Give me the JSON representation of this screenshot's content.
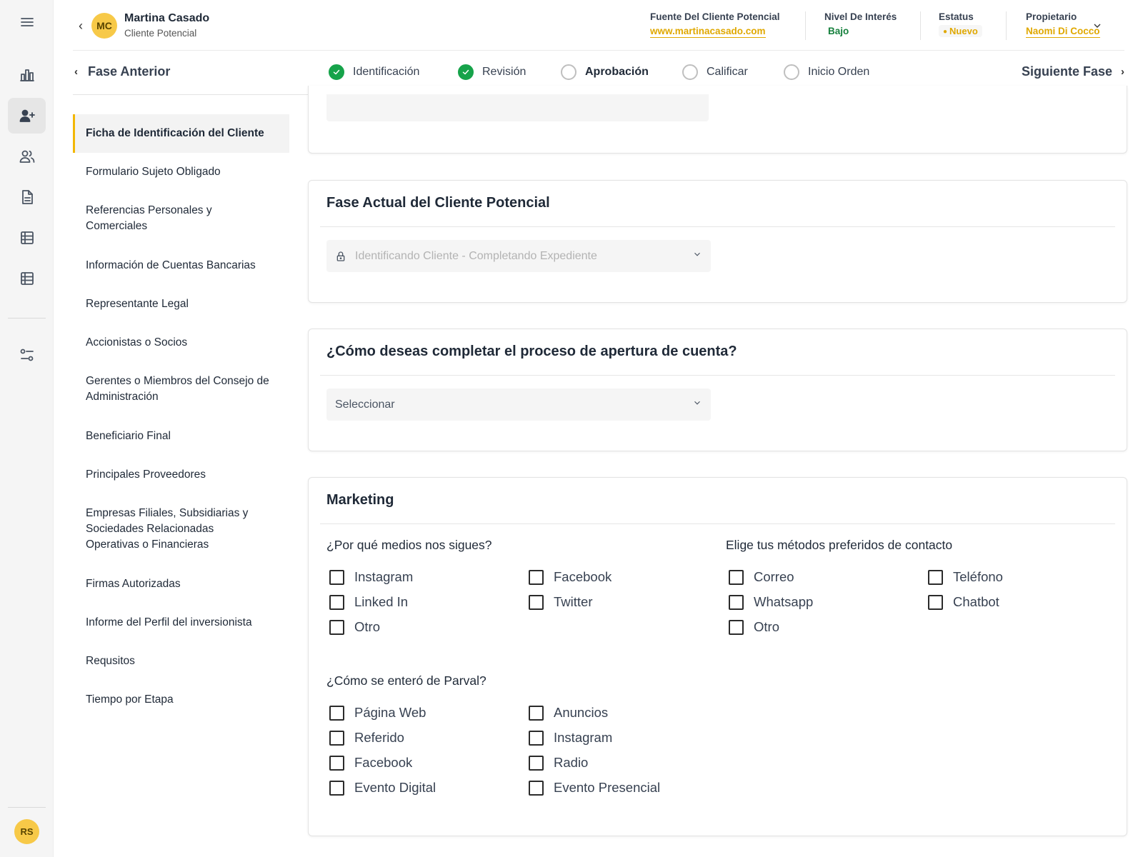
{
  "user": {
    "initials": "RS"
  },
  "header": {
    "back_label": "‹",
    "lead_initials": "MC",
    "lead_name": "Martina Casado",
    "lead_type": "Cliente Potencial",
    "source_label": "Fuente Del Cliente Potencial",
    "source_value": "www.martinacasado.com",
    "interest_label": "Nivel De Interés",
    "interest_value": "Bajo",
    "status_label": "Estatus",
    "status_value": "Nuevo",
    "owner_label": "Propietario",
    "owner_value": "Naomi Di Cocco"
  },
  "stages": {
    "prev_label": "Fase Anterior",
    "next_label": "Siguiente Fase",
    "steps": [
      {
        "label": "Identificación",
        "state": "done"
      },
      {
        "label": "Revisión",
        "state": "done"
      },
      {
        "label": "Aprobación",
        "state": "current"
      },
      {
        "label": "Calificar",
        "state": "pending"
      },
      {
        "label": "Inicio Orden",
        "state": "pending"
      }
    ]
  },
  "section_nav": {
    "items": [
      "Ficha de Identificación del Cliente",
      "Formulario Sujeto Obligado",
      "Referencias Personales y Comerciales",
      "Información de Cuentas Bancarias",
      "Representante Legal",
      "Accionistas o Socios",
      "Gerentes o Miembros del Consejo de Administración",
      "Beneficiario Final",
      "Principales Proveedores",
      "Empresas Filiales, Subsidiarias y Sociedades Relacionadas Operativas o Financieras",
      "Firmas Autorizadas",
      "Informe del Perfil del inversionista",
      "Requsitos",
      "Tiempo por Etapa"
    ]
  },
  "phase_card": {
    "title": "Fase Actual del Cliente Potencial",
    "select_value": "Identificando Cliente - Completando Expediente"
  },
  "opening_card": {
    "title": "¿Cómo deseas completar el proceso de apertura de cuenta?",
    "select_placeholder": "Seleccionar"
  },
  "marketing": {
    "title": "Marketing",
    "follow": {
      "question": "¿Por qué medios nos sigues?",
      "options": [
        "Instagram",
        "Facebook",
        "Linked In",
        "Twitter",
        "Otro"
      ]
    },
    "contact": {
      "question": "Elige tus métodos preferidos de contacto",
      "options": [
        "Correo",
        "Teléfono",
        "Whatsapp",
        "Chatbot",
        "Otro"
      ]
    },
    "heard": {
      "question": "¿Cómo se enteró de Parval?",
      "options": [
        "Página Web",
        "Anuncios",
        "Referido",
        "Instagram",
        "Facebook",
        "Radio",
        "Evento Digital",
        "Evento Presencial"
      ]
    }
  }
}
